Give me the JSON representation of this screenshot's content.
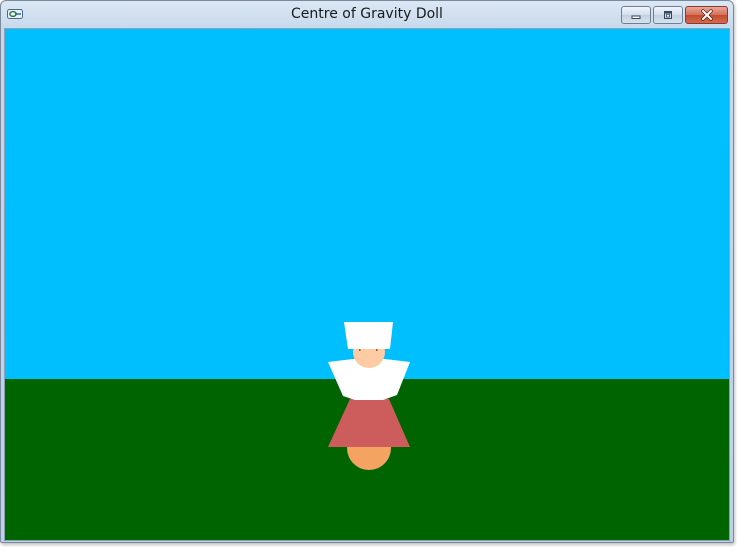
{
  "window": {
    "title": "Centre of Gravity Doll",
    "icons": {
      "app": "app-icon",
      "minimize": "minimize-icon",
      "maximize": "maximize-icon",
      "close": "close-icon"
    }
  },
  "scene": {
    "sky_color": "#00bfff",
    "ground_color": "#006400",
    "doll": {
      "bonnet_color": "#ffffff",
      "face_color": "#ffcba4",
      "collar_color": "#ffffff",
      "skirt_color": "#cd5c5c",
      "base_color": "#f4a460"
    }
  }
}
